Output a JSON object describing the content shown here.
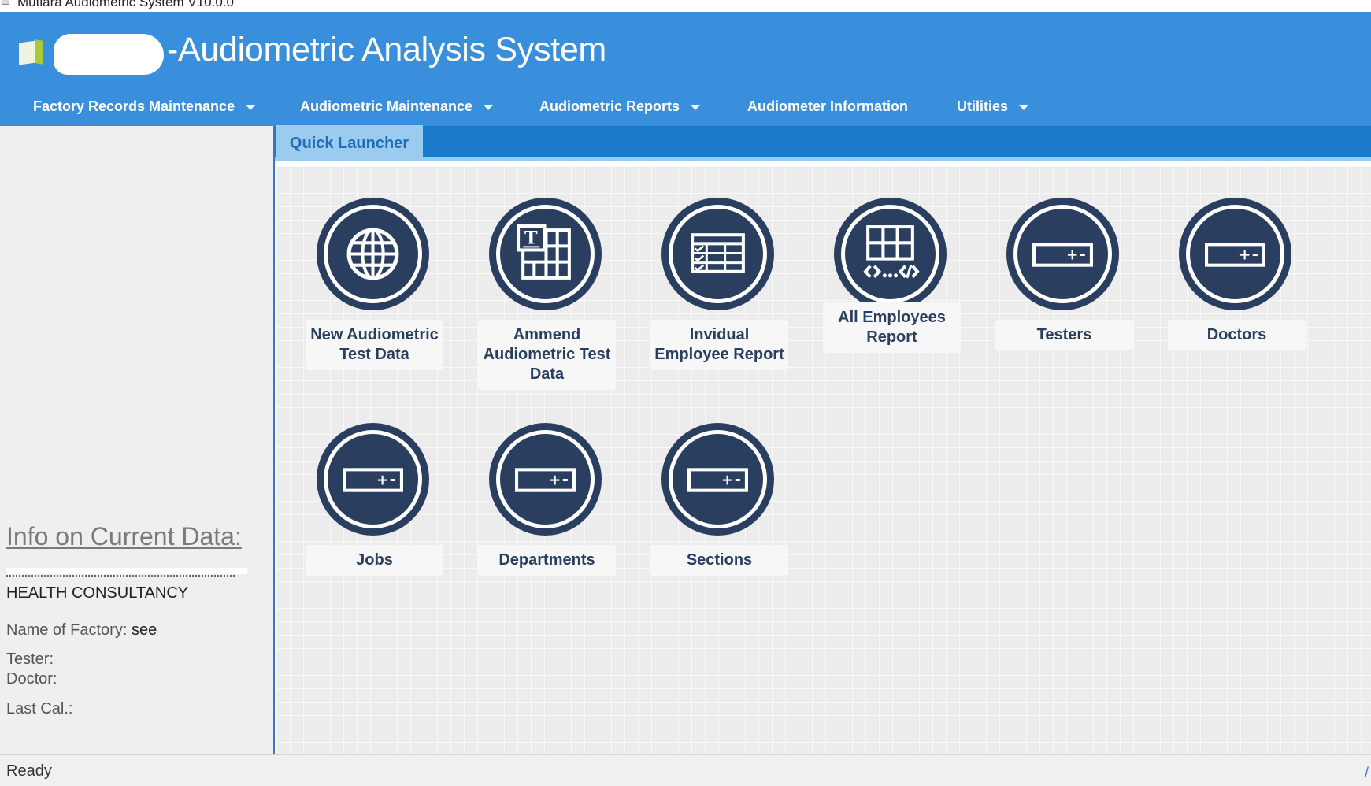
{
  "window": {
    "title": "Mutiara Audiometric System V10.0.0"
  },
  "header": {
    "app_title": "-Audiometric Analysis System",
    "menu": [
      {
        "label": "Factory Records Maintenance",
        "has_dropdown": true
      },
      {
        "label": "Audiometric Maintenance",
        "has_dropdown": true
      },
      {
        "label": "Audiometric Reports",
        "has_dropdown": true
      },
      {
        "label": "Audiometer Information",
        "has_dropdown": false
      },
      {
        "label": "Utilities",
        "has_dropdown": true
      }
    ]
  },
  "tabs": [
    {
      "label": "Quick Launcher",
      "active": true
    }
  ],
  "launcher": {
    "tiles": [
      {
        "label": "New Audiometric Test Data",
        "icon": "globe-icon"
      },
      {
        "label": "Ammend Audiometric Test Data",
        "icon": "edit-table-icon"
      },
      {
        "label": "Invidual Employee Report",
        "icon": "checklist-grid-icon"
      },
      {
        "label": "All Employees Report",
        "icon": "code-grid-icon"
      },
      {
        "label": "Testers",
        "icon": "form-field-icon"
      },
      {
        "label": "Doctors",
        "icon": "form-field-icon"
      },
      {
        "label": "Jobs",
        "icon": "form-field-icon"
      },
      {
        "label": "Departments",
        "icon": "form-field-icon"
      },
      {
        "label": "Sections",
        "icon": "form-field-icon"
      }
    ]
  },
  "info_panel": {
    "heading": "Info on Current Data:",
    "company_tail": "HEALTH CONSULTANCY",
    "factory_label": "Name of Factory:",
    "factory_value": "see",
    "tester_label": "Tester:",
    "doctor_label": "Doctor:",
    "last_cal_label": "Last Cal.:"
  },
  "status_bar": {
    "text": "Ready"
  },
  "colors": {
    "header_blue": "#3a8fdc",
    "tab_strip_blue": "#1a7acb",
    "tab_active": "#9ccbf0",
    "icon_navy": "#2a3f60"
  }
}
